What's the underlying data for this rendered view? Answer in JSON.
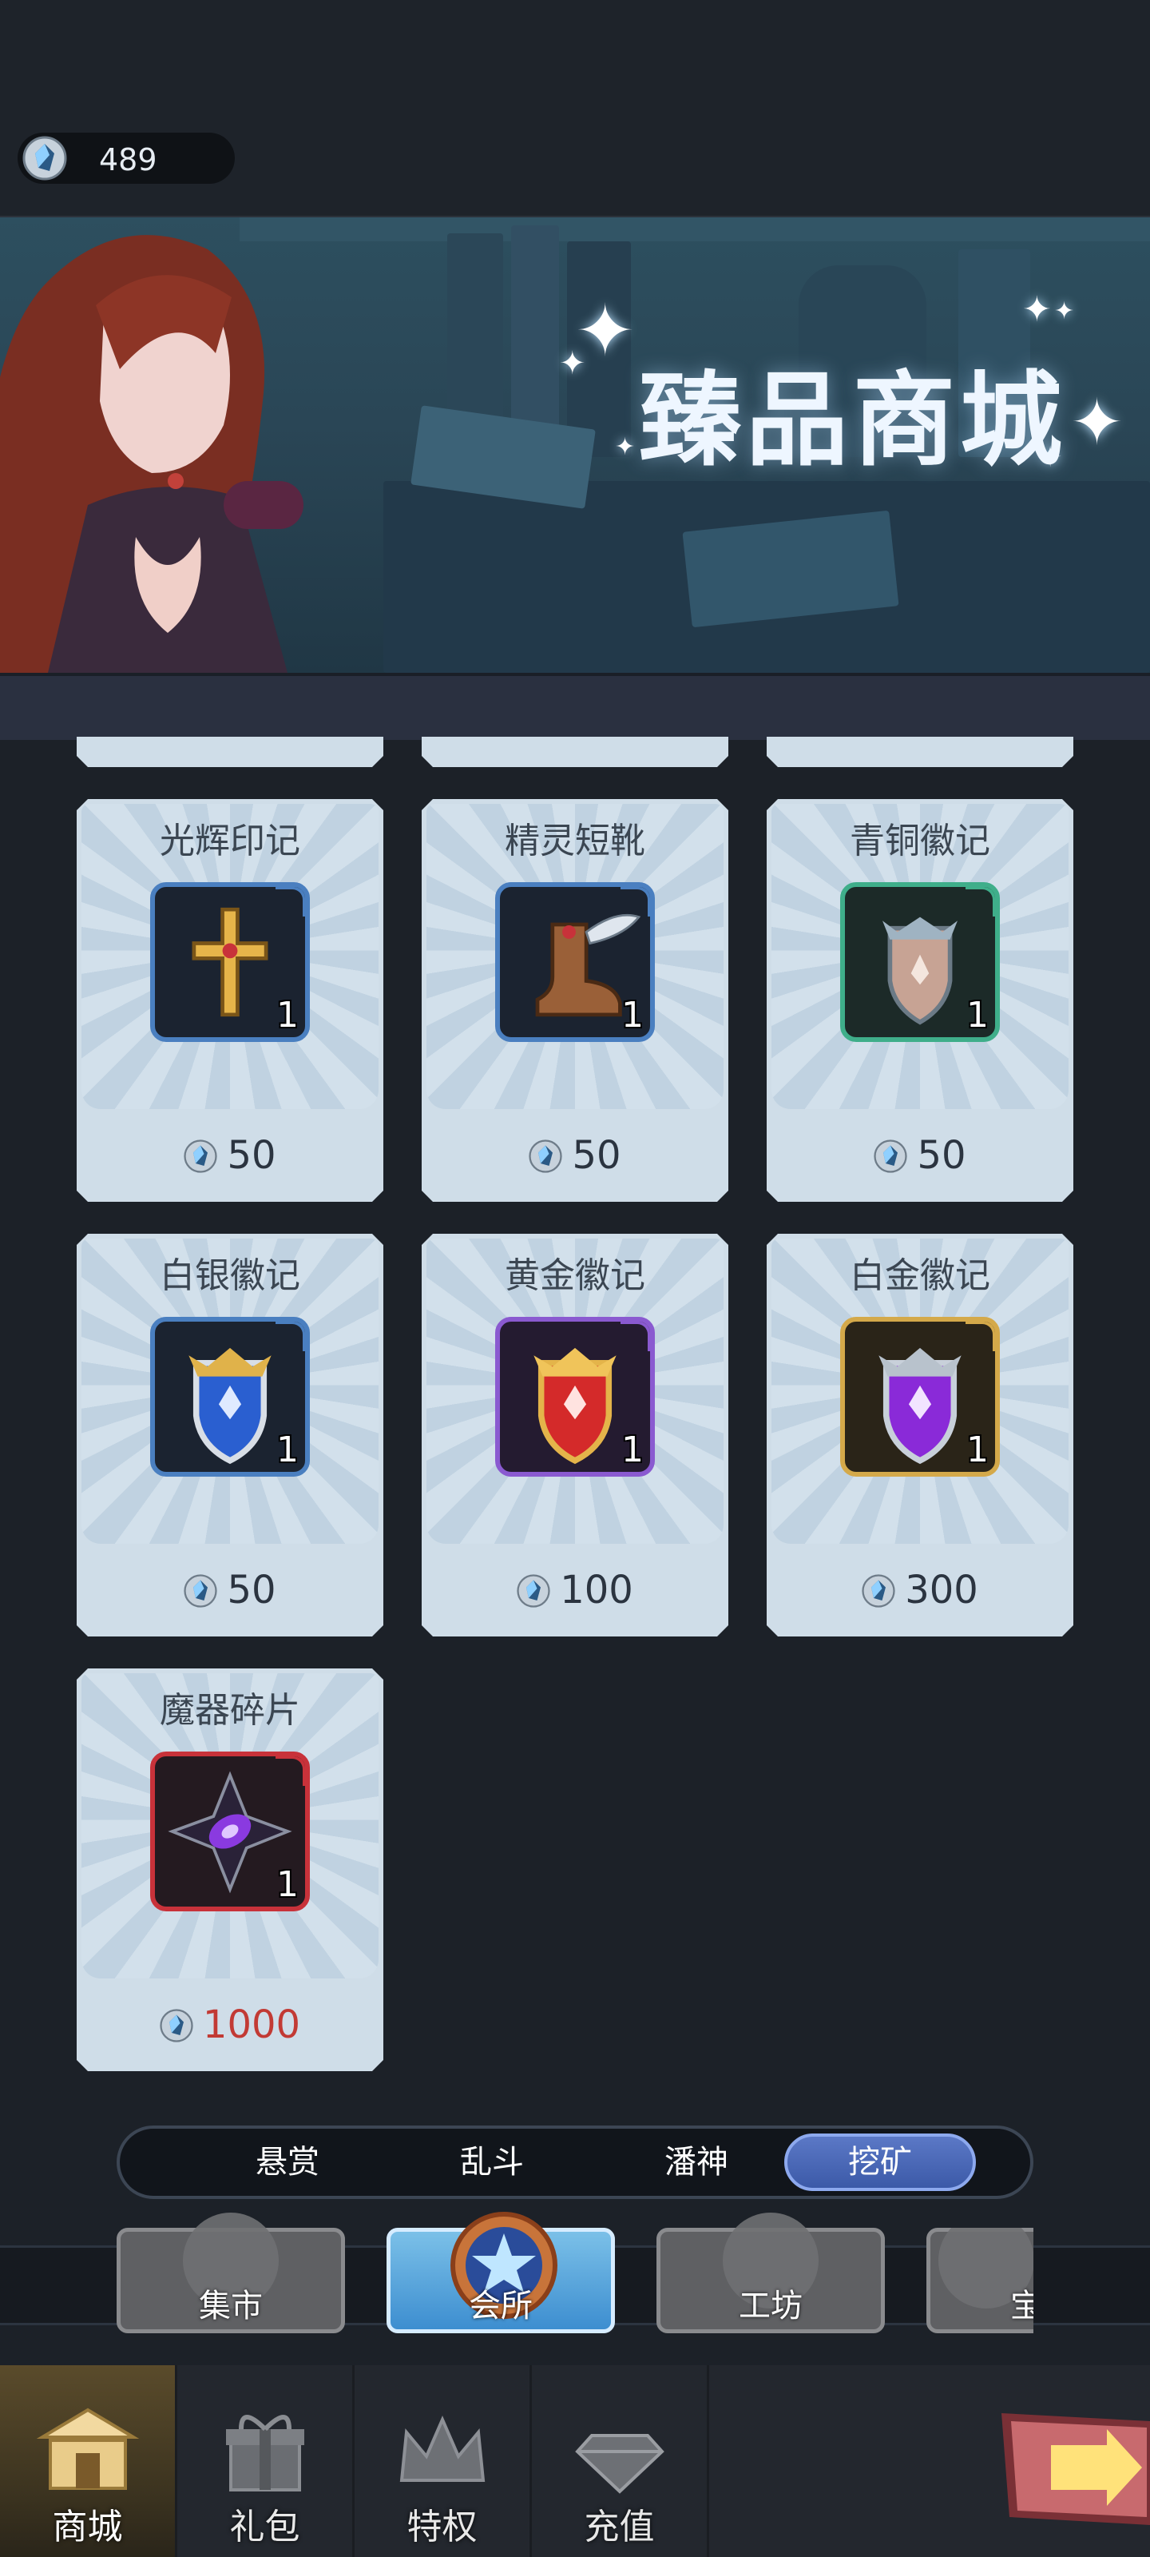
{
  "top": {
    "currency_value": "489"
  },
  "banner": {
    "title": "臻品商城"
  },
  "items": [
    {
      "name": "光辉印记",
      "qty": "1",
      "price": "50",
      "icon": "radiant-cross-icon",
      "frame": "#4a7fc0",
      "expensive": false
    },
    {
      "name": "精灵短靴",
      "qty": "1",
      "price": "50",
      "icon": "winged-boot-icon",
      "frame": "#4a7fc0",
      "expensive": false
    },
    {
      "name": "青铜徽记",
      "qty": "1",
      "price": "50",
      "icon": "bronze-emblem-icon",
      "frame": "#3fae8a",
      "expensive": false
    },
    {
      "name": "白银徽记",
      "qty": "1",
      "price": "50",
      "icon": "silver-emblem-icon",
      "frame": "#4a7fc0",
      "expensive": false
    },
    {
      "name": "黄金徽记",
      "qty": "1",
      "price": "100",
      "icon": "gold-emblem-icon",
      "frame": "#8a5ad0",
      "expensive": false
    },
    {
      "name": "白金徽记",
      "qty": "1",
      "price": "300",
      "icon": "platinum-emblem-icon",
      "frame": "#d4a94a",
      "expensive": false
    },
    {
      "name": "魔器碎片",
      "qty": "1",
      "price": "1000",
      "icon": "artifact-shard-icon",
      "frame": "#c8323a",
      "expensive": true
    }
  ],
  "subtabs": [
    {
      "label": "悬赏",
      "active": false
    },
    {
      "label": "乱斗",
      "active": false
    },
    {
      "label": "潘神",
      "active": false
    },
    {
      "label": "挖矿",
      "active": true
    }
  ],
  "shop_tabs": [
    {
      "label": "集市",
      "icon": "coin-bag-icon",
      "active": false
    },
    {
      "label": "会所",
      "icon": "star-medallion-icon",
      "active": true
    },
    {
      "label": "工坊",
      "icon": "gear-workshop-icon",
      "active": false
    },
    {
      "label": "宝",
      "icon": "treasure-icon",
      "active": false
    }
  ],
  "nav": [
    {
      "label": "商城",
      "icon": "shop-building-icon",
      "active": true
    },
    {
      "label": "礼包",
      "icon": "gift-box-icon",
      "active": false
    },
    {
      "label": "特权",
      "icon": "crown-icon",
      "active": false
    },
    {
      "label": "充值",
      "icon": "diamond-icon",
      "active": false
    }
  ],
  "colors": {
    "card_bg": "#cfdde8",
    "price_red": "#c23a34",
    "active_tab": "#4c68b8"
  }
}
